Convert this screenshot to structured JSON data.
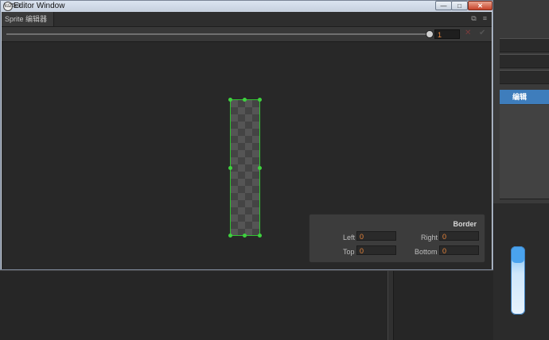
{
  "window": {
    "title": "Editor Window",
    "min_label": "—",
    "max_label": "□",
    "close_label": "✕"
  },
  "tab": {
    "label": "Sprite 编辑器"
  },
  "toolbar": {
    "zoom_value": "1",
    "revert_label": "✕",
    "apply_label": "✔"
  },
  "background_panel": {
    "selected_label": "编辑"
  },
  "border": {
    "title": "Border",
    "left_label": "Left",
    "left_value": "0",
    "right_label": "Right",
    "right_value": "0",
    "top_label": "Top",
    "top_value": "0",
    "bottom_label": "Bottom",
    "bottom_value": "0"
  },
  "colors": {
    "accent": "#3e7dbc",
    "handle": "#3fd13f",
    "value_text": "#e8843a"
  }
}
